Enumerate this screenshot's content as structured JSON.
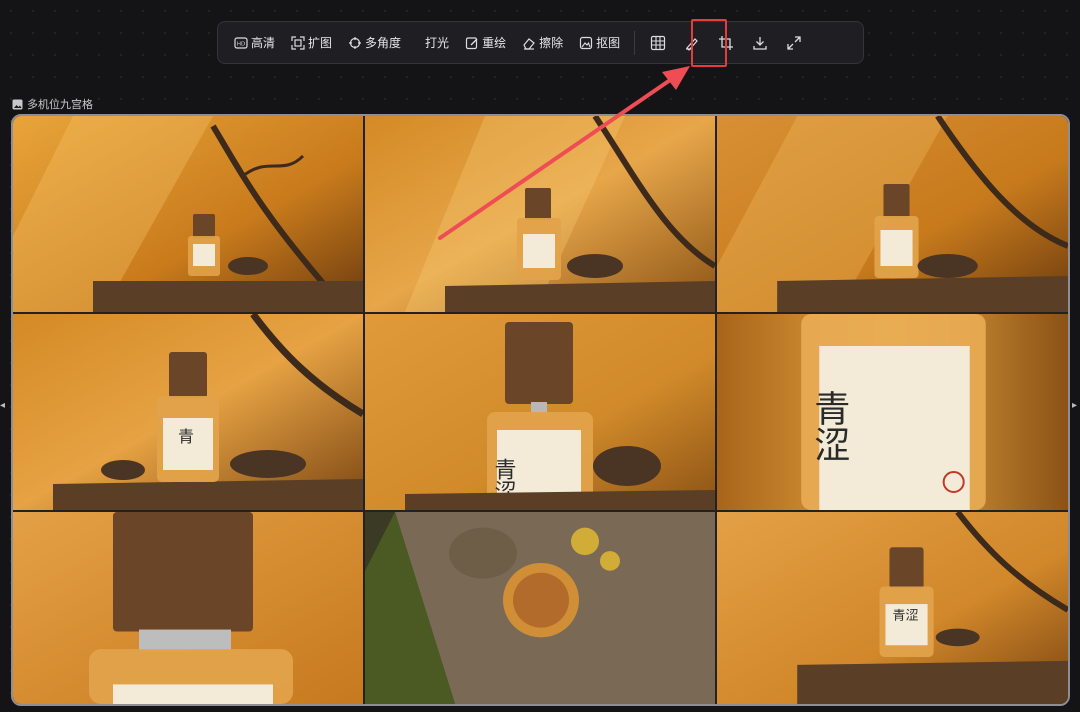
{
  "toolbar": {
    "buttons": [
      {
        "label": "高清",
        "icon": "hd-icon"
      },
      {
        "label": "扩图",
        "icon": "expand-image-icon"
      },
      {
        "label": "多角度",
        "icon": "multi-angle-icon"
      },
      {
        "label": "打光",
        "icon": ""
      },
      {
        "label": "重绘",
        "icon": "redraw-icon"
      },
      {
        "label": "擦除",
        "icon": "eraser-icon"
      },
      {
        "label": "抠图",
        "icon": "cutout-icon"
      }
    ],
    "icon_buttons": [
      "grid-icon",
      "brush-icon",
      "crop-icon",
      "download-icon",
      "fullscreen-icon"
    ],
    "highlighted": "grid-icon"
  },
  "canvas": {
    "label": "多机位九宫格"
  },
  "images": [
    {
      "name": "view-1",
      "label": "",
      "desc": "bottle-on-wood-branch"
    },
    {
      "name": "view-2",
      "label": "",
      "desc": "bottle-centered-petals"
    },
    {
      "name": "view-3",
      "label": "",
      "desc": "bottle-right-branch"
    },
    {
      "name": "view-4",
      "label": "青",
      "desc": "bottle-closer"
    },
    {
      "name": "view-5",
      "label": "青涩",
      "desc": "bottle-medium-closeup"
    },
    {
      "name": "view-6",
      "label": "青涩",
      "desc": "label-extreme-closeup"
    },
    {
      "name": "view-7",
      "label": "",
      "desc": "cap-closeup"
    },
    {
      "name": "view-8",
      "label": "",
      "desc": "top-down-wood"
    },
    {
      "name": "view-9",
      "label": "青涩",
      "desc": "bottle-wide"
    }
  ],
  "colors": {
    "accent": "#e53d3d",
    "warm": "#d9901f"
  }
}
